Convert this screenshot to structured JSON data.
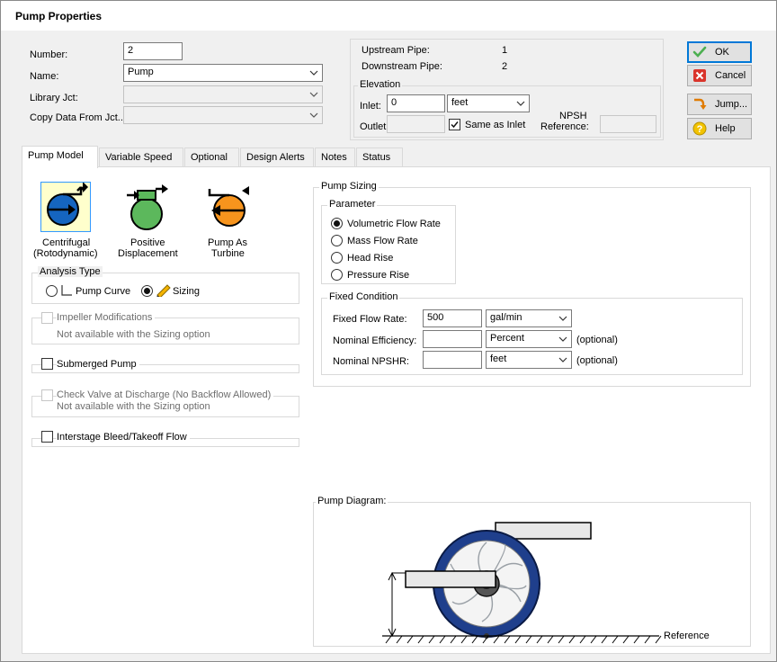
{
  "window": {
    "title": "Pump Properties"
  },
  "fields": {
    "number_label": "Number:",
    "number_value": "2",
    "name_label": "Name:",
    "name_value": "Pump",
    "library_label": "Library Jct:",
    "library_value": "",
    "copy_label": "Copy Data From Jct...",
    "copy_value": ""
  },
  "pipes": {
    "upstream_label": "Upstream Pipe:",
    "upstream_value": "1",
    "downstream_label": "Downstream Pipe:",
    "downstream_value": "2"
  },
  "elevation": {
    "title": "Elevation",
    "inlet_label": "Inlet:",
    "inlet_value": "0",
    "unit": "feet",
    "outlet_label": "Outlet:",
    "outlet_value": "",
    "same_as_inlet_label": "Same as Inlet",
    "same_as_inlet_checked": true,
    "npsh_label_1": "NPSH",
    "npsh_label_2": "Reference:",
    "npsh_value": ""
  },
  "buttons": {
    "ok": "OK",
    "cancel": "Cancel",
    "jump": "Jump...",
    "help": "Help"
  },
  "tabs": [
    {
      "label": "Pump Model",
      "active": true
    },
    {
      "label": "Variable Speed",
      "active": false
    },
    {
      "label": "Optional",
      "active": false
    },
    {
      "label": "Design Alerts",
      "active": false
    },
    {
      "label": "Notes",
      "active": false
    },
    {
      "label": "Status",
      "active": false
    }
  ],
  "pump_models": [
    {
      "label_1": "Centrifugal",
      "label_2": "(Rotodynamic)",
      "icon": "centrifugal-pump-icon",
      "color": "#1565c0",
      "selected": true
    },
    {
      "label_1": "Positive",
      "label_2": "Displacement",
      "icon": "positive-displacement-pump-icon",
      "color": "#5cb85c",
      "selected": false
    },
    {
      "label_1": "Pump As",
      "label_2": "Turbine",
      "icon": "pump-as-turbine-icon",
      "color": "#f7941d",
      "selected": false
    }
  ],
  "analysis": {
    "title": "Analysis Type",
    "pump_curve_label": "Pump Curve",
    "sizing_label": "Sizing",
    "selected": "Sizing"
  },
  "options": {
    "impeller_label": "Impeller Modifications",
    "impeller_note": "Not available with the Sizing option",
    "submerged_label": "Submerged Pump",
    "check_valve_label": "Check Valve at Discharge (No Backflow Allowed)",
    "check_valve_note": "Not available with the Sizing option",
    "interstage_label": "Interstage Bleed/Takeoff Flow"
  },
  "sizing": {
    "title": "Pump Sizing",
    "parameter_title": "Parameter",
    "parameters": [
      "Volumetric Flow Rate",
      "Mass Flow Rate",
      "Head Rise",
      "Pressure Rise"
    ],
    "selected_parameter": "Volumetric Flow Rate",
    "fixed_title": "Fixed Condition",
    "flow_label": "Fixed Flow Rate:",
    "flow_value": "500",
    "flow_unit": "gal/min",
    "efficiency_label": "Nominal Efficiency:",
    "efficiency_value": "",
    "efficiency_unit": "Percent",
    "npshr_label": "Nominal NPSHR:",
    "npshr_value": "",
    "npshr_unit": "feet",
    "optional_label": "(optional)"
  },
  "diagram": {
    "title": "Pump Diagram:",
    "reference_label": "Reference"
  },
  "colors": {
    "accent": "#0078d7",
    "pump_blue": "#1565c0",
    "pump_green": "#5cb85c",
    "pump_orange": "#f7941d",
    "volute": "#1f3f8c"
  }
}
